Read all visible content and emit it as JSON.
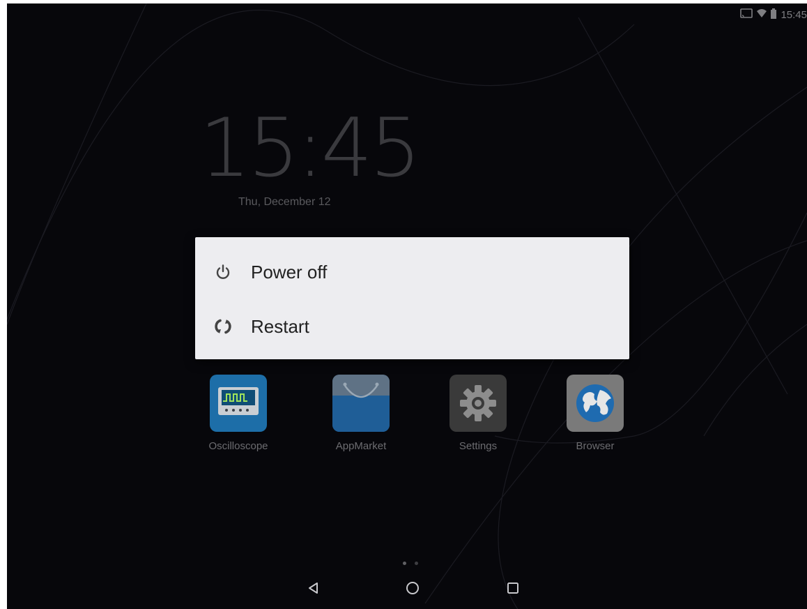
{
  "status_bar": {
    "time": "15:45",
    "icons": [
      "cast-icon",
      "wifi-icon",
      "battery-icon"
    ]
  },
  "lockscreen": {
    "clock": "15:45",
    "date": "Thu, December 12"
  },
  "power_menu": {
    "items": [
      {
        "label": "Power off",
        "icon": "power-icon"
      },
      {
        "label": "Restart",
        "icon": "restart-icon"
      }
    ]
  },
  "apps": [
    {
      "label": "Oscilloscope",
      "icon": "oscilloscope-icon",
      "color": "#1d6ea8"
    },
    {
      "label": "AppMarket",
      "icon": "shopping-bag-icon",
      "color": "#1f5e97"
    },
    {
      "label": "Settings",
      "icon": "gear-icon",
      "color": "#3a3a3a"
    },
    {
      "label": "Browser",
      "icon": "globe-icon",
      "color": "#7a7a7a"
    }
  ],
  "page_indicator": {
    "pages": 2,
    "active": 1
  },
  "nav_bar": {
    "buttons": [
      "back-icon",
      "home-icon",
      "recents-icon"
    ]
  },
  "colors": {
    "screen_bg": "#07070b",
    "dialog_bg": "#ededf0",
    "dialog_text": "#212121",
    "dimmed_text": "#6c6c70"
  }
}
